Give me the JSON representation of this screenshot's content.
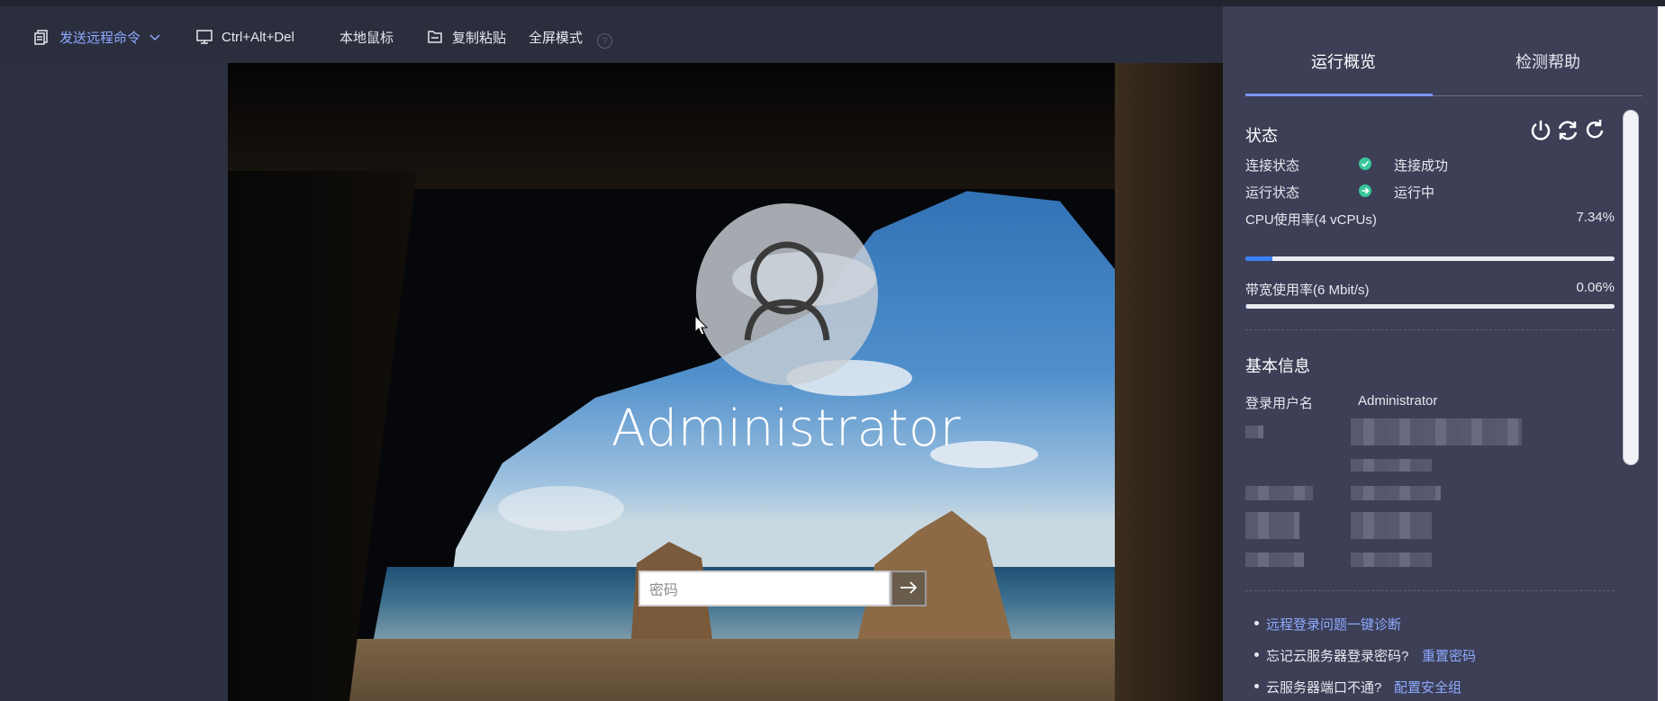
{
  "toolbar": {
    "send_command": "发送远程命令",
    "ctrl_alt_del": "Ctrl+Alt+Del",
    "local_mouse": "本地鼠标",
    "copy_paste": "复制粘贴",
    "fullscreen": "全屏模式",
    "help": "?"
  },
  "screen": {
    "username": "Administrator",
    "password_placeholder": "密码"
  },
  "panel": {
    "tabs": [
      "运行概览",
      "检测帮助"
    ],
    "status": {
      "title": "状态",
      "connection_label": "连接状态",
      "connection_value": "连接成功",
      "run_label": "运行状态",
      "run_value": "运行中",
      "cpu_label": "CPU使用率(4 vCPUs)",
      "cpu_value": "7.34%",
      "cpu_fraction": 0.0734,
      "bandwidth_label": "带宽使用率(6 Mbit/s)",
      "bandwidth_value": "0.06%",
      "bandwidth_fraction": 0.0006
    },
    "basic_info": {
      "title": "基本信息",
      "login_user_label": "登录用户名",
      "login_user_value": "Administrator"
    },
    "help_links": {
      "diagnose": "远程登录问题一键诊断",
      "forgot_text": "忘记云服务器登录密码?",
      "reset_link": "重置密码",
      "port_text": "云服务器端口不通?",
      "security_link": "配置安全组"
    }
  },
  "colors": {
    "accent": "#7d93ff",
    "success": "#3ac69b",
    "link": "#8ea9ff",
    "progress": "#3a7ff6"
  }
}
